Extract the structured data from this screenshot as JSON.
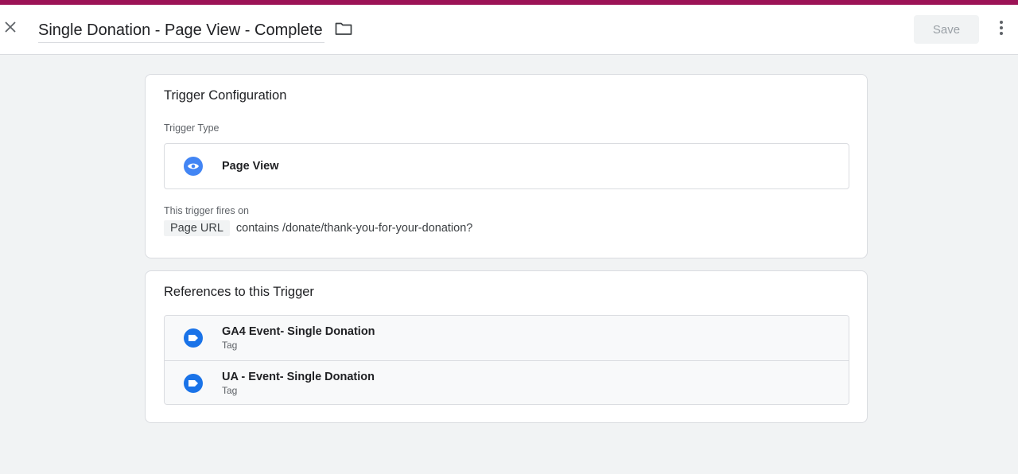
{
  "colors": {
    "accent": "#9c1356",
    "icon_blue": "#4285f4",
    "tag_blue": "#1a73e8"
  },
  "header": {
    "title": "Single Donation - Page View - Complete",
    "save_label": "Save",
    "icons": [
      "close-icon",
      "folder-icon",
      "more-vert-icon"
    ]
  },
  "trigger_config": {
    "title": "Trigger Configuration",
    "type_label": "Trigger Type",
    "type_name": "Page View",
    "type_icon": "eye-icon",
    "fires_on_label": "This trigger fires on",
    "condition": {
      "variable": "Page URL",
      "expression": "contains /donate/thank-you-for-your-donation?"
    }
  },
  "references": {
    "title": "References to this Trigger",
    "items": [
      {
        "name": "GA4 Event- Single Donation",
        "type": "Tag",
        "icon": "tag-icon"
      },
      {
        "name": "UA - Event- Single Donation",
        "type": "Tag",
        "icon": "tag-icon"
      }
    ]
  }
}
